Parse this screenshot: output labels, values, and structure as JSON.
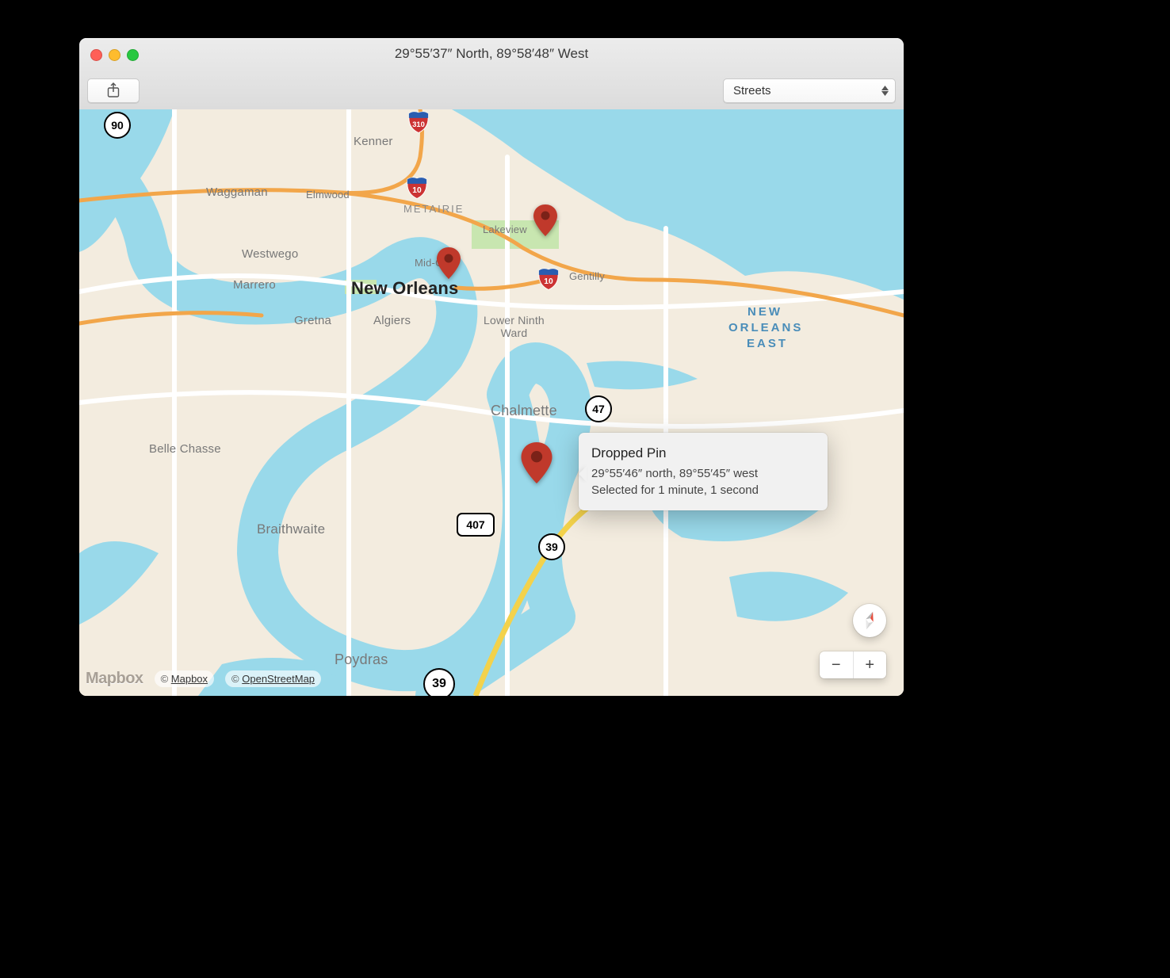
{
  "window": {
    "title": "29°55′37″ North, 89°58′48″ West"
  },
  "toolbar": {
    "share_name": "share",
    "style_selected": "Streets"
  },
  "callout": {
    "title": "Dropped Pin",
    "coords": "29°55′46″ north, 89°55′45″ west",
    "duration": "Selected for 1 minute, 1 second"
  },
  "labels": {
    "kenner": "Kenner",
    "waggaman": "Waggaman",
    "elmwood": "Elmwood",
    "metairie": "METAIRIE",
    "lakeview": "Lakeview",
    "westwego": "Westwego",
    "midcity": "Mid-City",
    "gentilly": "Gentilly",
    "neworleans": "New Orleans",
    "marrero": "Marrero",
    "gretna": "Gretna",
    "algiers": "Algiers",
    "lower9": "Lower Ninth\nWard",
    "noe1": "NEW",
    "noe2": "ORLEANS",
    "noe3": "EAST",
    "belle": "Belle Chasse",
    "chalmette": "Chalmette",
    "braith": "Braithwaite",
    "poydras": "Poydras"
  },
  "shields": {
    "i310": "310",
    "i10a": "10",
    "i10b": "10",
    "us90": "90",
    "r47": "47",
    "r407": "407",
    "r39a": "39",
    "r39b": "39"
  },
  "attrib": {
    "logo": "Mapbox",
    "mapbox": "Mapbox",
    "osm": "OpenStreetMap",
    "copy": "©"
  },
  "zoom": {
    "out": "−",
    "in": "+"
  }
}
